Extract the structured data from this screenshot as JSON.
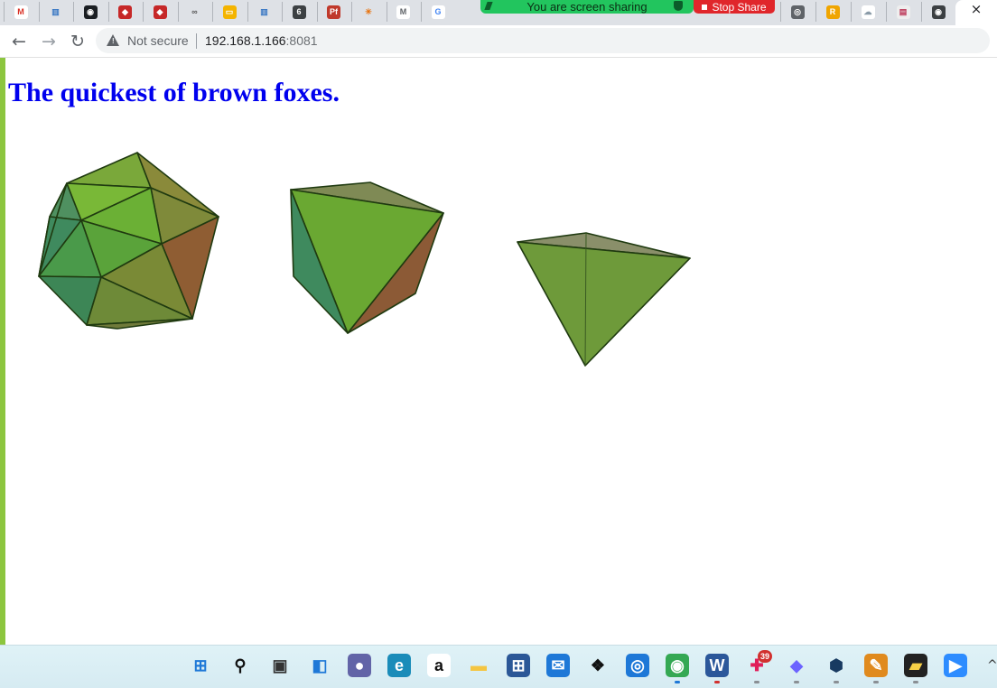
{
  "browser": {
    "tabs": [
      {
        "icon": "gmail-icon",
        "glyph": "M",
        "fg": "#d93025",
        "bg": "#ffffff"
      },
      {
        "icon": "bars-icon",
        "glyph": "▥",
        "fg": "#3a78c4",
        "bg": "#dee1e6"
      },
      {
        "icon": "github-icon",
        "glyph": "◉",
        "fg": "#ffffff",
        "bg": "#1b1f23"
      },
      {
        "icon": "red-cube-icon",
        "glyph": "◆",
        "fg": "#ffffff",
        "bg": "#c62828"
      },
      {
        "icon": "red-cube-icon",
        "glyph": "◆",
        "fg": "#ffffff",
        "bg": "#c62828"
      },
      {
        "icon": "glasses-icon",
        "glyph": "∞",
        "fg": "#555555",
        "bg": "#dee1e6"
      },
      {
        "icon": "slides-icon",
        "glyph": "▭",
        "fg": "#ffffff",
        "bg": "#f4b400"
      },
      {
        "icon": "bars-icon",
        "glyph": "▥",
        "fg": "#3a78c4",
        "bg": "#dee1e6"
      },
      {
        "icon": "six-icon",
        "glyph": "6",
        "fg": "#ffffff",
        "bg": "#3c4043"
      },
      {
        "icon": "pf-icon",
        "glyph": "Pf",
        "fg": "#ffffff",
        "bg": "#c0392b"
      },
      {
        "icon": "sparkle-icon",
        "glyph": "✳",
        "fg": "#e8710a",
        "bg": "#dee1e6"
      },
      {
        "icon": "medium-icon",
        "glyph": "M",
        "fg": "#5f6368",
        "bg": "#ffffff"
      },
      {
        "icon": "google-icon",
        "glyph": "G",
        "fg": "#4285f4",
        "bg": "#ffffff"
      }
    ],
    "tabs_right": [
      {
        "icon": "globe-icon",
        "glyph": "◎",
        "fg": "#ffffff",
        "bg": "#5f6368"
      },
      {
        "icon": "r-icon",
        "glyph": "R",
        "fg": "#ffffff",
        "bg": "#f0a500"
      },
      {
        "icon": "cloud-icon",
        "glyph": "☁",
        "fg": "#8a9ba8",
        "bg": "#ffffff"
      },
      {
        "icon": "image-icon",
        "glyph": "▤",
        "fg": "#b35",
        "bg": "#eeeeee"
      },
      {
        "icon": "chrome-icon",
        "glyph": "◉",
        "fg": "#ffffff",
        "bg": "#3c4043"
      }
    ],
    "share_banner": "You are screen sharing",
    "stop_share": "Stop Share",
    "active_tab_close": "×",
    "nav": {
      "back": "←",
      "forward": "→",
      "reload": "↻"
    },
    "security_label": "Not secure",
    "url_host": "192.168.1.166",
    "url_port": ":8081"
  },
  "page": {
    "title": "The quickest of brown foxes."
  },
  "taskbar": {
    "icons": [
      {
        "name": "windows-start-icon",
        "glyph": "⊞",
        "fg": "#1e78d7",
        "bg": "transparent"
      },
      {
        "name": "search-icon",
        "glyph": "⚲",
        "fg": "#111111",
        "bg": "transparent"
      },
      {
        "name": "task-view-icon",
        "glyph": "▣",
        "fg": "#333333",
        "bg": "transparent"
      },
      {
        "name": "widgets-icon",
        "glyph": "◧",
        "fg": "#1e78d7",
        "bg": "transparent"
      },
      {
        "name": "chat-icon",
        "glyph": "●",
        "fg": "#ffffff",
        "bg": "#6264a7"
      },
      {
        "name": "edge-icon",
        "glyph": "e",
        "fg": "#ffffff",
        "bg": "#1a8cb9"
      },
      {
        "name": "amazon-icon",
        "glyph": "a",
        "fg": "#111111",
        "bg": "#ffffff"
      },
      {
        "name": "file-explorer-icon",
        "glyph": "▬",
        "fg": "#f4c542",
        "bg": "transparent"
      },
      {
        "name": "store-icon",
        "glyph": "⊞",
        "fg": "#ffffff",
        "bg": "#2b5797"
      },
      {
        "name": "mail-icon",
        "glyph": "✉",
        "fg": "#ffffff",
        "bg": "#1e78d7"
      },
      {
        "name": "dropbox-icon",
        "glyph": "❖",
        "fg": "#111111",
        "bg": "transparent"
      },
      {
        "name": "vpn-icon",
        "glyph": "◎",
        "fg": "#ffffff",
        "bg": "#1e78d7"
      },
      {
        "name": "chrome-icon",
        "glyph": "◉",
        "fg": "#ffffff",
        "bg": "#34a853"
      },
      {
        "name": "word-icon",
        "glyph": "W",
        "fg": "#ffffff",
        "bg": "#2b579a"
      },
      {
        "name": "slack-icon",
        "glyph": "✚",
        "fg": "#e01e5a",
        "bg": "transparent"
      },
      {
        "name": "diamond-app-icon",
        "glyph": "◆",
        "fg": "#6c63ff",
        "bg": "transparent"
      },
      {
        "name": "virtualbox-icon",
        "glyph": "⬢",
        "fg": "#183a61",
        "bg": "transparent"
      },
      {
        "name": "paint-icon",
        "glyph": "✎",
        "fg": "#ffffff",
        "bg": "#e08a1e"
      },
      {
        "name": "sticky-notes-icon",
        "glyph": "▰",
        "fg": "#f7d046",
        "bg": "#222222"
      },
      {
        "name": "zoom-icon",
        "glyph": "▶",
        "fg": "#ffffff",
        "bg": "#2d8cff"
      }
    ],
    "slack_badge": "39",
    "tray_chevron": "^"
  },
  "colors": {
    "link_blue": "#0000ee",
    "accent_green": "#8cc63f",
    "poly_edge": "#1f3a10"
  }
}
